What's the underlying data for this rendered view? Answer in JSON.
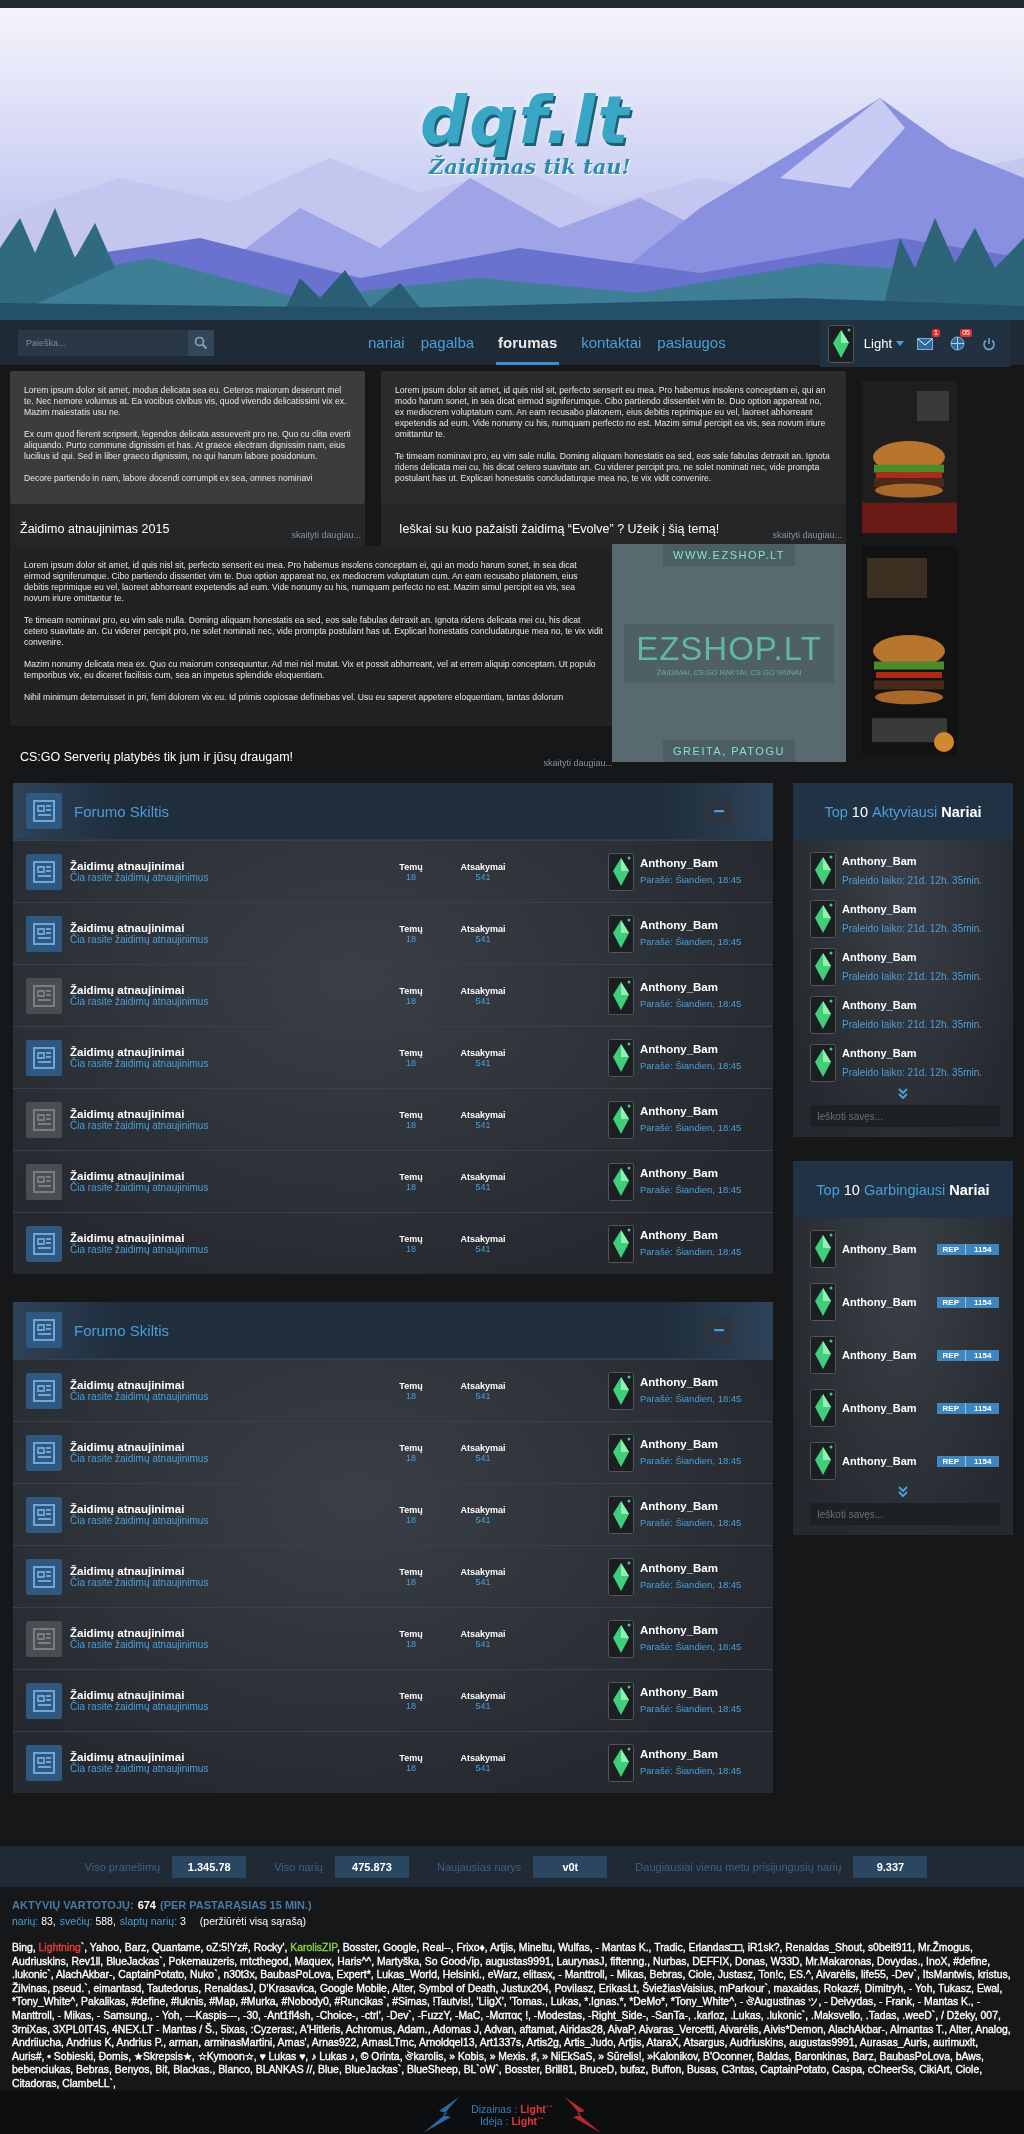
{
  "logo": {
    "name": "dqf.lt",
    "tagline": "Žaidimas tik tau!"
  },
  "nav": {
    "search": {
      "placeholder": "Paieška..."
    },
    "links": [
      {
        "label": "nariai",
        "selected": false
      },
      {
        "label": "pagalba",
        "selected": false
      },
      {
        "label": "forumas",
        "selected": true
      },
      {
        "label": "kontaktai",
        "selected": false
      },
      {
        "label": "paslaugos",
        "selected": false
      }
    ],
    "user": {
      "name": "Light",
      "messages_badge": "1",
      "notifications_badge": "05"
    }
  },
  "news": [
    {
      "paragraphs": [
        "Lorem ipsum dolor sit amet, modus delicata sea eu. Ceteros maiorum deserunt mel te. Nec nemore volumus at. Ea vocibus civibus vis, quod vivendo delicatissimi vix ex. Mazim maiestatis usu ne.",
        "Ex cum quod fierent scripserit, legendos delicata assueverit pro ne. Quo cu clita everti aliquando. Purto commune dignissim et has. At graece electram dignissim nam, eius lucilius id qui. Sed in liber graeco dignissim, no qui harum labore posidonium.",
        "Decore partiendo in nam, labore docendi corrumpit ex sea, omnes nominavi"
      ],
      "title": "Žaidimo atnaujinimas 2015",
      "more": "skaityti daugiau..."
    },
    {
      "paragraphs": [
        "Lorem ipsum dolor sit amet, id quis nisl sit, perfecto senserit eu mea. Pro habemus insolens conceptam ei, qui an modo harum sonet, in sea dicat eirmod signiferumque. Cibo partiendo dissentiet vim te. Duo option appareat no, ex mediocrem voluptatum cum. An eam recusabo platonem, eius debitis reprimique eu vel, laoreet abhorreant expetendis ad eum. Vide nonumy cu his, numquam perfecto no est. Mazim simul percipit ea vis, sea novum iriure omittantur te.",
        "Te timeam nominavi pro, eu vim sale nulla. Doming aliquam honestatis ea sed, eos sale fabulas detraxit an. Ignota ridens delicata mei cu, his dicat cetero suavitate an. Cu viderer percipit pro, ne solet nominati nec, vide prompta postulant has ut. Explicari honestatis concludaturque mea no, te vix vidit convenire."
      ],
      "title": "Ieškai su kuo pažaisti žaidimą “Evolve” ? Užeik į šią temą!",
      "more": "skaityti daugiau..."
    },
    {
      "paragraphs": [
        "Lorem ipsum dolor sit amet, id quis nisl sit, perfecto senserit eu mea. Pro habemus insolens conceptam ei, qui an modo harum sonet, in sea dicat eirmod signiferumque. Cibo partiendo dissentiet vim te. Duo option appareat no, ex mediocrem voluptatum cum. An eam recusabo platonem, eius debitis reprimique eu vel, laoreet abhorreant expetendis ad eum. Vide nonumy cu his, numquam perfecto no est. Mazim simul percipit ea vis, sea novum iriure omittantur te.",
        "Te timeam nominavi pro, eu vim sale nulla. Doming aliquam honestatis ea sed, eos sale fabulas detraxit an. Ignota ridens delicata mei cu, his dicat cetero suavitate an. Cu viderer percipit pro, ne solet nominati nec, vide prompta postulant has ut. Explicari honestatis concludaturque mea no, te vix vidit convenire.",
        "Mazim nonumy delicata mea ex. Quo cu maiorum consequuntur. Ad mei nisl mutat. Vix et possit abhorreant, vel at errem aliquip conceptam. Ut populo temporibus vix, eu diceret facilisis cum, sea an impetus splendide eloquentiam.",
        "Nihil minimum deterruisset in pri, ferri dolorem vix eu. Id primis copiosae definiebas vel. Usu eu saperet appetere eloquentiam, tantas dolorum"
      ],
      "title": "CS:GO Serverių platybės tik jum ir jūsų draugam!",
      "more": "skaityti daugiau..."
    }
  ],
  "ezshop": {
    "url": "WWW.EZSHOP.LT",
    "name": "EZSHOP.LT",
    "subtitle": "ŽAIDIMAI, CS:GO RAKTAI, CS:GO SKINAI",
    "slogan": "GREITA, PATOGU"
  },
  "forum_sections": [
    {
      "title": "Forumo Skiltis",
      "collapse": "−",
      "rows": [
        {
          "title": "Žaidimų atnaujinimai",
          "description": "Čia rasite žaidimų atnaujinimus",
          "topics_label": "Temų",
          "topics": "18",
          "replies_label": "Atsakymai",
          "replies": "541",
          "user": "Anthony_Bam",
          "posted": "Parašė: Šiandien, 18:45",
          "unread": true
        },
        {
          "title": "Žaidimų atnaujinimai",
          "description": "Čia rasite žaidimų atnaujinimus",
          "topics_label": "Temų",
          "topics": "18",
          "replies_label": "Atsakymai",
          "replies": "541",
          "user": "Anthony_Bam",
          "posted": "Parašė: Šiandien, 18:45",
          "unread": true
        },
        {
          "title": "Žaidimų atnaujinimai",
          "description": "Čia rasite žaidimų atnaujinimus",
          "topics_label": "Temų",
          "topics": "18",
          "replies_label": "Atsakymai",
          "replies": "541",
          "user": "Anthony_Bam",
          "posted": "Parašė: Šiandien, 18:45",
          "unread": false
        },
        {
          "title": "Žaidimų atnaujinimai",
          "description": "Čia rasite žaidimų atnaujinimus",
          "topics_label": "Temų",
          "topics": "18",
          "replies_label": "Atsakymai",
          "replies": "541",
          "user": "Anthony_Bam",
          "posted": "Parašė: Šiandien, 18:45",
          "unread": true
        },
        {
          "title": "Žaidimų atnaujinimai",
          "description": "Čia rasite žaidimų atnaujinimus",
          "topics_label": "Temų",
          "topics": "18",
          "replies_label": "Atsakymai",
          "replies": "541",
          "user": "Anthony_Bam",
          "posted": "Parašė: Šiandien, 18:45",
          "unread": false
        },
        {
          "title": "Žaidimų atnaujinimai",
          "description": "Čia rasite žaidimų atnaujinimus",
          "topics_label": "Temų",
          "topics": "18",
          "replies_label": "Atsakymai",
          "replies": "541",
          "user": "Anthony_Bam",
          "posted": "Parašė: Šiandien, 18:45",
          "unread": false
        },
        {
          "title": "Žaidimų atnaujinimai",
          "description": "Čia rasite žaidimų atnaujinimus",
          "topics_label": "Temų",
          "topics": "18",
          "replies_label": "Atsakymai",
          "replies": "541",
          "user": "Anthony_Bam",
          "posted": "Parašė: Šiandien, 18:45",
          "unread": true
        }
      ]
    },
    {
      "title": "Forumo Skiltis",
      "collapse": "−",
      "rows": [
        {
          "title": "Žaidimų atnaujinimai",
          "description": "Čia rasite žaidimų atnaujinimus",
          "topics_label": "Temų",
          "topics": "18",
          "replies_label": "Atsakymai",
          "replies": "541",
          "user": "Anthony_Bam",
          "posted": "Parašė: Šiandien, 18:45",
          "unread": true
        },
        {
          "title": "Žaidimų atnaujinimai",
          "description": "Čia rasite žaidimų atnaujinimus",
          "topics_label": "Temų",
          "topics": "18",
          "replies_label": "Atsakymai",
          "replies": "541",
          "user": "Anthony_Bam",
          "posted": "Parašė: Šiandien, 18:45",
          "unread": true
        },
        {
          "title": "Žaidimų atnaujinimai",
          "description": "Čia rasite žaidimų atnaujinimus",
          "topics_label": "Temų",
          "topics": "18",
          "replies_label": "Atsakymai",
          "replies": "541",
          "user": "Anthony_Bam",
          "posted": "Parašė: Šiandien, 18:45",
          "unread": true
        },
        {
          "title": "Žaidimų atnaujinimai",
          "description": "Čia rasite žaidimų atnaujinimus",
          "topics_label": "Temų",
          "topics": "18",
          "replies_label": "Atsakymai",
          "replies": "541",
          "user": "Anthony_Bam",
          "posted": "Parašė: Šiandien, 18:45",
          "unread": true
        },
        {
          "title": "Žaidimų atnaujinimai",
          "description": "Čia rasite žaidimų atnaujinimus",
          "topics_label": "Temų",
          "topics": "18",
          "replies_label": "Atsakymai",
          "replies": "541",
          "user": "Anthony_Bam",
          "posted": "Parašė: Šiandien, 18:45",
          "unread": false
        },
        {
          "title": "Žaidimų atnaujinimai",
          "description": "Čia rasite žaidimų atnaujinimus",
          "topics_label": "Temų",
          "topics": "18",
          "replies_label": "Atsakymai",
          "replies": "541",
          "user": "Anthony_Bam",
          "posted": "Parašė: Šiandien, 18:45",
          "unread": true
        },
        {
          "title": "Žaidimų atnaujinimai",
          "description": "Čia rasite žaidimų atnaujinimus",
          "topics_label": "Temų",
          "topics": "18",
          "replies_label": "Atsakymai",
          "replies": "541",
          "user": "Anthony_Bam",
          "posted": "Parašė: Šiandien, 18:45",
          "unread": true
        }
      ]
    }
  ],
  "side_panels": [
    {
      "kind": "time",
      "title": [
        {
          "text": "Top",
          "color": "#4a9fd8"
        },
        {
          "text": "10",
          "color": "#ffffff"
        },
        {
          "text": "Aktyviausi",
          "color": "#4a9fd8"
        },
        {
          "text": "Nariai",
          "color": "#ffffff"
        }
      ],
      "search": {
        "placeholder": "Ieškoti savęs..."
      },
      "members": [
        {
          "name": "Anthony_Bam",
          "info": "Praleido laiko: 21d. 12h. 35min."
        },
        {
          "name": "Anthony_Bam",
          "info": "Praleido laiko: 21d. 12h. 35min."
        },
        {
          "name": "Anthony_Bam",
          "info": "Praleido laiko: 21d. 12h. 35min."
        },
        {
          "name": "Anthony_Bam",
          "info": "Praleido laiko: 21d. 12h. 35min."
        },
        {
          "name": "Anthony_Bam",
          "info": "Praleido laiko: 21d. 12h. 35min."
        }
      ]
    },
    {
      "kind": "rep",
      "title": [
        {
          "text": "Top",
          "color": "#4a9fd8"
        },
        {
          "text": "10",
          "color": "#ffffff"
        },
        {
          "text": "Garbingiausi",
          "color": "#4a9fd8"
        },
        {
          "text": "Nariai",
          "color": "#ffffff"
        }
      ],
      "search": {
        "placeholder": "Ieškoti savęs..."
      },
      "members": [
        {
          "name": "Anthony_Bam",
          "rep_label": "REP",
          "rep": "1154"
        },
        {
          "name": "Anthony_Bam",
          "rep_label": "REP",
          "rep": "1154"
        },
        {
          "name": "Anthony_Bam",
          "rep_label": "REP",
          "rep": "1154"
        },
        {
          "name": "Anthony_Bam",
          "rep_label": "REP",
          "rep": "1154"
        },
        {
          "name": "Anthony_Bam",
          "rep_label": "REP",
          "rep": "1154"
        }
      ]
    }
  ],
  "stats": [
    {
      "label": "Viso pranešimų",
      "value": "1.345.78"
    },
    {
      "label": "Viso narių",
      "value": "475.873"
    },
    {
      "label": "Naujausias narys",
      "value": "v0t"
    },
    {
      "label": "Daugiausiai vienu metu prisijungusių narių",
      "value": "9.337"
    }
  ],
  "active": {
    "label": "AKTYVIŲ VARTOTOJŲ:",
    "count": "674",
    "period": "(PER PASTARĄSIAS 15 MIN.)",
    "counts": [
      {
        "label": "narių:",
        "value": "83,"
      },
      {
        "label": "svečių:",
        "value": "588,"
      },
      {
        "label": "slaptų narių:",
        "value": "3"
      }
    ],
    "list_link": "(peržiūrėti visą sąrašą)",
    "users": [
      {
        "text": "Bing, ",
        "color": "#ffffff"
      },
      {
        "text": "Lightning",
        "color": "#e8403a"
      },
      {
        "text": "`, Yahoo, Barz, Quantame, oZ:5!Yz#, Rocky', ",
        "color": "#ffffff"
      },
      {
        "text": "KarolisZIP",
        "color": "#8ad04a"
      },
      {
        "text": ", Bosster, Google, Real--, Frixo♦, Artjis, Mineltu, Wulfas, - Mantas K., Tradic, Erlandas□□, iR1sk?, Renaldas_Shout, s0beit911, Mr.Žmogus, Audriuskins, Rev1ll, BlueJackas`, Pokemauzeris, mtcthegod, Maquex, Haris^^, Martyška, So Good√ip, augustas9991, LaurynasJ, fiftenng., Nurbas, DEFFIX, Donas, W33D, Mr.Makaronas, Dovydas., InoX, #define, .lukonic`, AlachAkbar-, CaptainPotato, Nuko`, n30t3x, BaubasPoLova, Expert*, Lukas_World, Helsinki., eWarz, elitasx, - Manttroll, - Mikas, Bebras, Ciole, Justasz, Ton!c, ES.^, Aivarėlis, life55, -Dev`, ItsMantwis, kristus, Žilvinas, pseud.`, eimantasd, Tautedorus, RenaldasJ, D'Krasavica, Google Mobile, Alter, Symbol of Death, Justux204, Povilasz, ErikasLt, ŠviežiasVaisius, mParkour`, maxaidas, Rokaz#, Dimitryh, - Yoh, Tukasz, Ewal, *Tony_White^, Pakalikas, #define, #luknis, #Map, #Murka, #Nobody0, #Runcikas`, #Simas, !Tautvis!, 'LiigX', 'Tomas., Lukas, *.Ignas.*, *DeMo*, *Tony_White^, - ঔAugustinas ツ, - Deivydas, - Frank, - Mantas K., - Manttroll, - Mikas, - Samsung., - Yoh, ---Kaspis---, -30, -Ant1fl4sh, -Choice-, -ctrl', -Dev`, -FuzzY, -MaC, -Mαπας !, -Modestas, -Right_Side-, -SanTa-, .karloz, .Lukas, .lukonic`, .Maksvello, .Tadas, .weeD`, / Džeky, 007, 3rniXas, 3XPL0IT4S, 4NEX.LT - Mantas / Š., 5ixas, :Cyzeras:, A'Hitleris, Achromus, Adam., Adomas J, Advan, aftamat, Airidas28, AivaP, Aivaras_Vercetti, Aivarėlis, Aivis*Demon, AlachAkbar-, Almantas T., Alter, Analog, Andriiucha, Andrius K, Andrius P., arman, arminasMartini, Arnas', Arnas922, ArnasLTmc, Arnoldqel13, Art1337s, Artis2g, Artis_Judo, Artjis, AtaraX, Atsargus, Audriuskins, augustas9991, Aurasas_Auris, aurimuxlt, Auris#, • Sobieski, Đomis, ★Skrepsis★, ☆Kymoon☆, ♥ Lukas ♥, ♪ Lukas ♪, © Orinta, ঔkarolis, » Kobis, » Mexis. ♯, » NiEkSaS, » Sūrelis!, »Kalonikov, B'Oconner, Baldas, Baronkinas, Barz, BaubasPoLova, bAws, bebenciukas, Bebras, Benyos, Bit, Blackas., Blanco, BLANKAS //, Blue, BlueJackas`, BlueSheep, BL`oW`, Bosster, Brill81, BruceD, bufaz, Buffon, Busas, C3ntas, CaptainPotato, Caspa, cCheerSs, CikiArt, Ciole, Citadoras, ClambeLL`,",
        "color": "#ffffff"
      }
    ]
  },
  "footer": {
    "lines": [
      {
        "label": "Dizainas :",
        "value": "Light``"
      },
      {
        "label": "Idėja :",
        "value": "Light``"
      }
    ]
  }
}
